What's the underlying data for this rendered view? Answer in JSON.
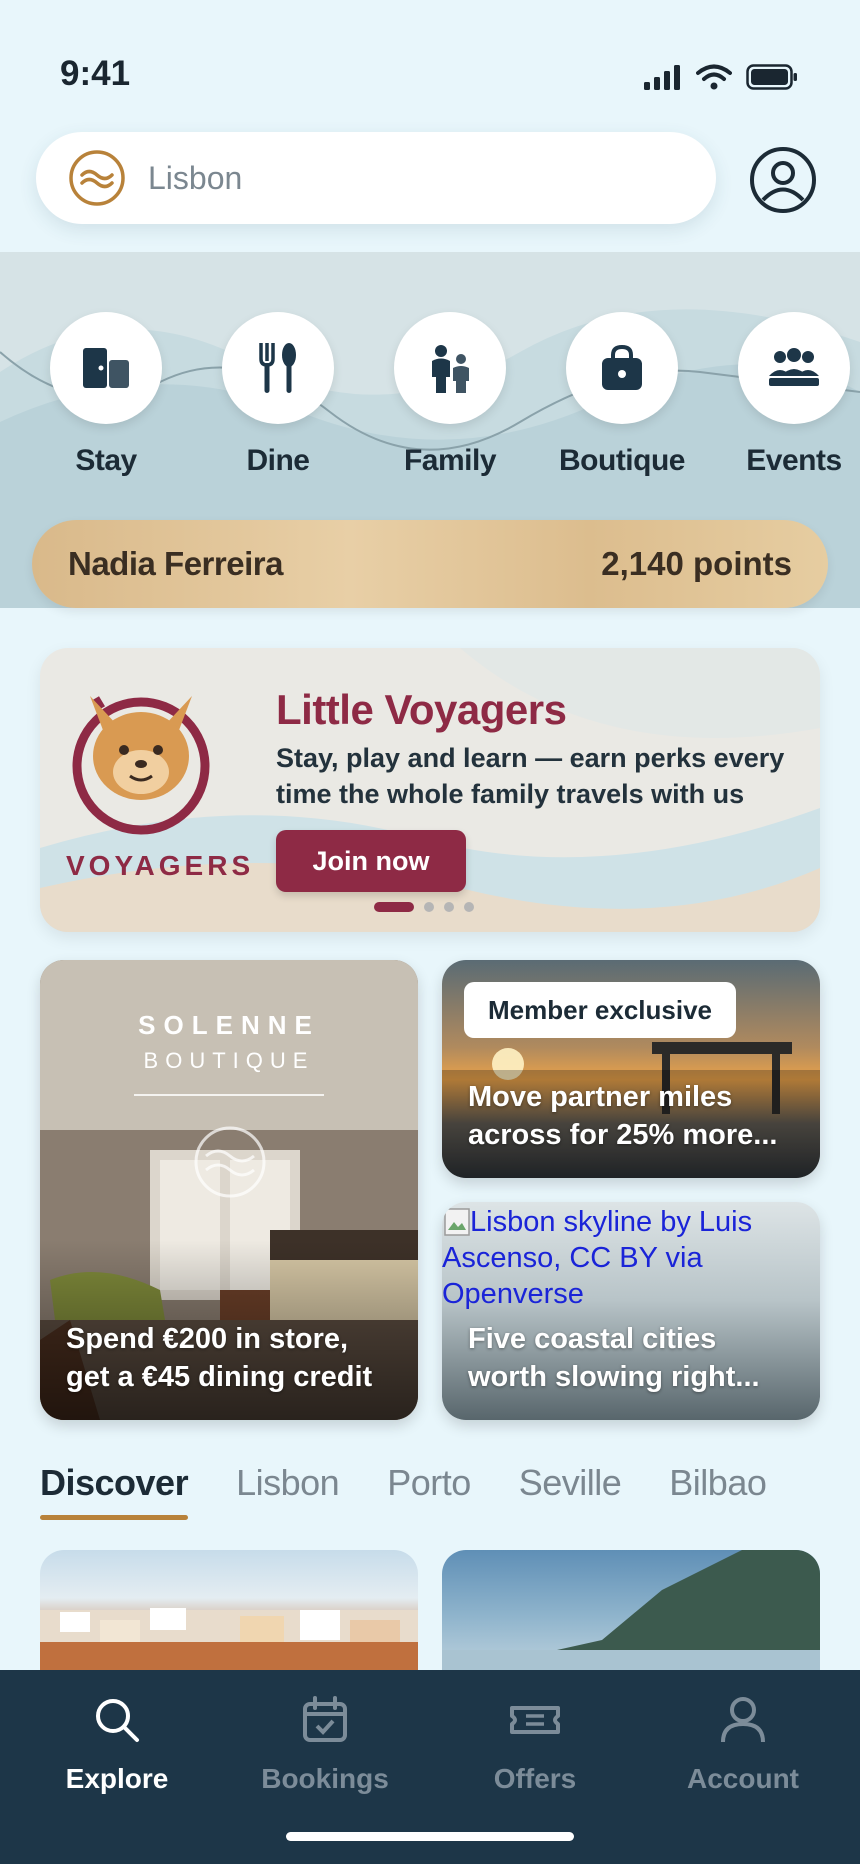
{
  "status": {
    "time": "9:41"
  },
  "search": {
    "value": "Lisbon"
  },
  "categories": [
    {
      "label": "Stay",
      "icon": "stay-icon"
    },
    {
      "label": "Dine",
      "icon": "dine-icon"
    },
    {
      "label": "Family",
      "icon": "family-icon"
    },
    {
      "label": "Boutique",
      "icon": "boutique-icon"
    },
    {
      "label": "Events",
      "icon": "events-icon"
    }
  ],
  "loyalty": {
    "name": "Nadia Ferreira",
    "points": "2,140 points"
  },
  "banner": {
    "title": "Little Voyagers",
    "subtitle": "Stay, play and learn — earn perks every time the whole family travels with us",
    "button": "Join now",
    "brand": "VOYAGERS",
    "active_slide": 1,
    "slide_count": 4
  },
  "cards": {
    "boutique": {
      "brand": "SOLENNE",
      "brand_sub": "BOUTIQUE",
      "caption": "Spend €200 in store, get a €45 dining credit"
    },
    "miles": {
      "badge": "Member exclusive",
      "caption": "Move partner miles across for 25% more..."
    },
    "coastal": {
      "image_alt": "Lisbon skyline by Luis Ascenso, CC BY via Openverse",
      "caption": "Five coastal cities worth slowing right..."
    }
  },
  "tabs": [
    {
      "label": "Discover",
      "active": true
    },
    {
      "label": "Lisbon",
      "active": false
    },
    {
      "label": "Porto",
      "active": false
    },
    {
      "label": "Seville",
      "active": false
    },
    {
      "label": "Bilbao",
      "active": false
    }
  ],
  "nav": [
    {
      "label": "Explore",
      "icon": "search-icon",
      "active": true
    },
    {
      "label": "Bookings",
      "icon": "calendar-icon",
      "active": false
    },
    {
      "label": "Offers",
      "icon": "ticket-icon",
      "active": false
    },
    {
      "label": "Account",
      "icon": "account-icon",
      "active": false
    }
  ],
  "colors": {
    "brand": "#8e2a45",
    "accent": "#b8823a",
    "nav_bg": "#1d3648",
    "background": "#e8f6fb"
  }
}
